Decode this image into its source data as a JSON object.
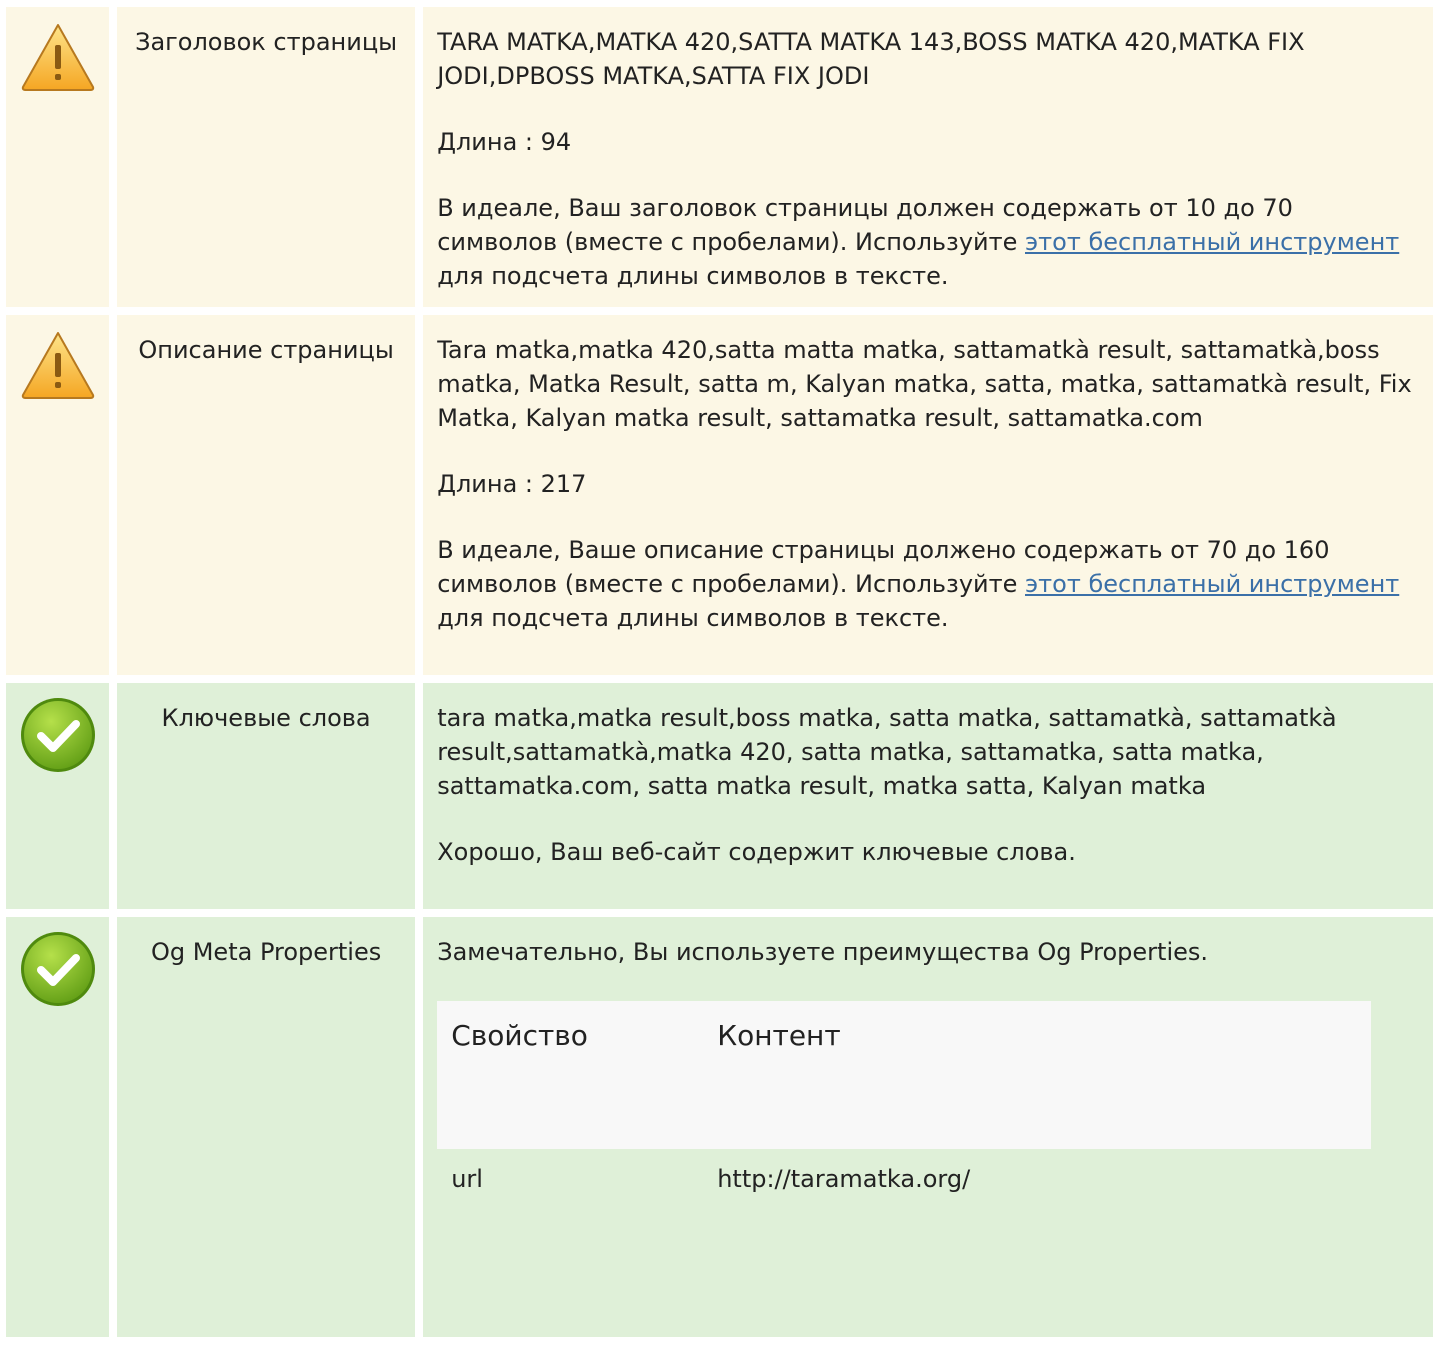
{
  "rows": [
    {
      "status": "warning",
      "icon": "warning-icon",
      "name": "Заголовок страницы",
      "value": "TARA MATKA,MATKA 420,SATTA MATKA 143,BOSS MATKA 420,MATKA FIX JODI,DPBOSS MATKA,SATTA FIX JODI",
      "length": "Длина : 94",
      "advice_before": "В идеале, Ваш заголовок страницы должен содержать от 10 до 70 символов (вместе с пробелами). Используйте ",
      "advice_link": "этот бесплатный инструмент",
      "advice_after": " для подсчета длины символов в тексте."
    },
    {
      "status": "warning",
      "icon": "warning-icon",
      "name": "Описание страницы",
      "value": "Tara matka,matka 420,satta matta matka, sattamatkà result, sattamatkà,boss matka, Matka Result, satta m, Kalyan matka, satta, matka, sattamatkà result, Fix Matka, Kalyan matka result, sattamatka result, sattamatka.com",
      "length": "Длина : 217",
      "advice_before": "В идеале, Ваше описание страницы должено содержать от 70 до 160 символов (вместе с пробелами). Используйте ",
      "advice_link": "этот бесплатный инструмент",
      "advice_after": " для подсчета длины символов в тексте."
    },
    {
      "status": "passed",
      "icon": "check-icon",
      "name": "Ключевые слова",
      "value": "tara matka,matka result,boss matka, satta matka, sattamatkà, sattamatkà result,sattamatkà,matka 420, satta matka, sattamatka, satta matka, sattamatka.com, satta matka result, matka satta, Kalyan matka",
      "message": "Хорошо, Ваш веб-сайт содержит ключевые слова."
    },
    {
      "status": "passed",
      "icon": "check-icon",
      "name": "Og Meta Properties",
      "message": "Замечательно, Вы используете преимущества Og Properties.",
      "og_table": {
        "headers": [
          "Свойство",
          "Контент"
        ],
        "rows": [
          {
            "property": "url",
            "content": "http://taramatka.org/"
          }
        ]
      }
    }
  ],
  "colors": {
    "warning_bg": "#fcf7e5",
    "passed_bg": "#dff0d8",
    "link": "#3b70a8",
    "warning_icon": "#f7b52c",
    "check_icon": "#7cb928"
  }
}
